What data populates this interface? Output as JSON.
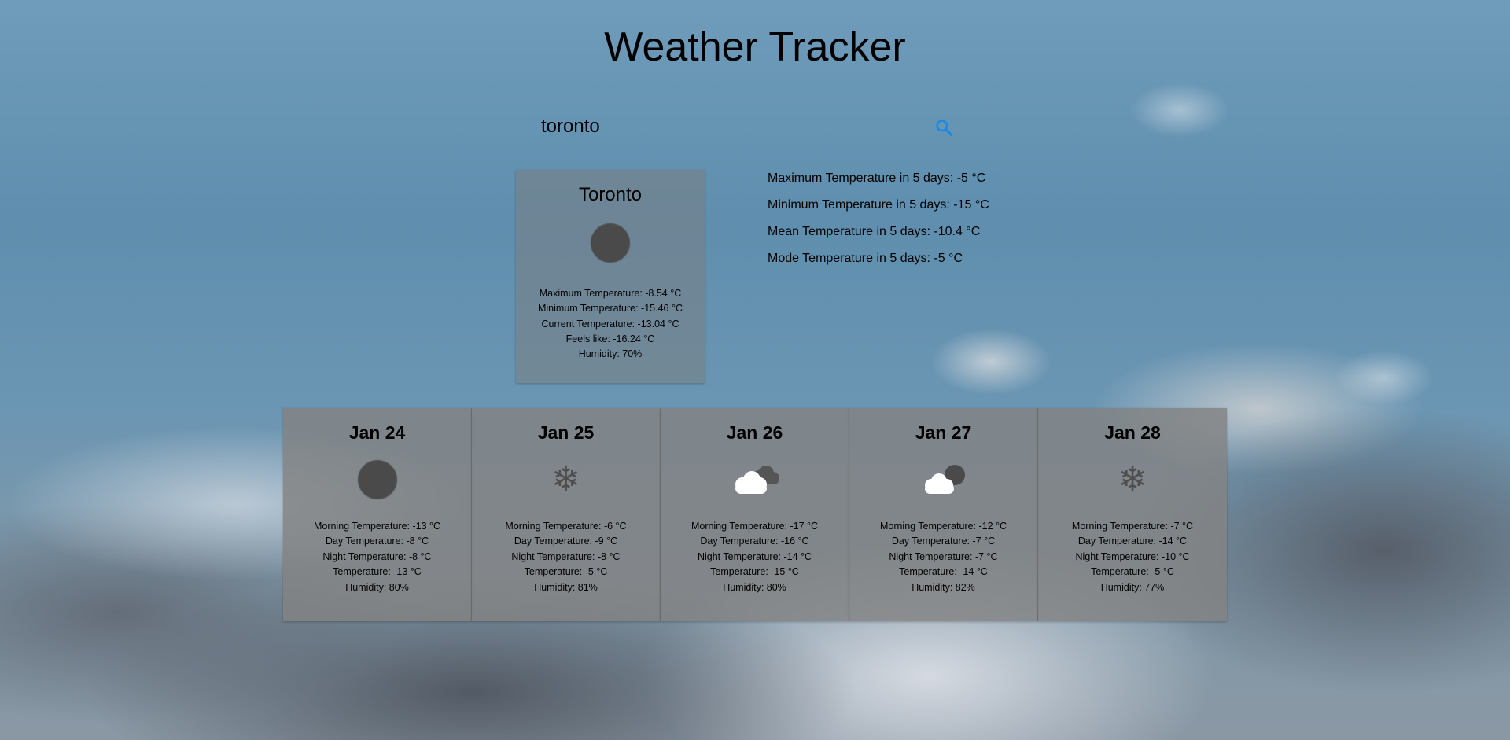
{
  "app": {
    "title": "Weather Tracker"
  },
  "search": {
    "value": "toronto",
    "button_icon": "search-icon",
    "accent_color": "#1e88e5"
  },
  "current": {
    "city": "Toronto",
    "icon": "dark-circle-icon",
    "stats": [
      "Maximum Temperature: -8.54 °C",
      "Minimum Temperature: -15.46 °C",
      "Current Temperature: -13.04 °C",
      "Feels like: -16.24 °C",
      "Humidity: 70%"
    ]
  },
  "summary": {
    "lines": [
      "Maximum Temperature in 5 days: -5 °C",
      "Minimum Temperature in 5 days: -15 °C",
      "Mean Temperature in 5 days: -10.4 °C",
      "Mode Temperature in 5 days: -5 °C"
    ]
  },
  "forecast": [
    {
      "date": "Jan 24",
      "icon": "dark-circle-icon",
      "lines": [
        "Morning Temperature: -13 °C",
        "Day Temperature: -8 °C",
        "Night Temperature: -8 °C",
        "Temperature: -13 °C",
        "Humidity: 80%"
      ]
    },
    {
      "date": "Jan 25",
      "icon": "snowflake-icon",
      "lines": [
        "Morning Temperature: -6 °C",
        "Day Temperature: -9 °C",
        "Night Temperature: -8 °C",
        "Temperature: -5 °C",
        "Humidity: 81%"
      ]
    },
    {
      "date": "Jan 26",
      "icon": "cloudy-icon",
      "lines": [
        "Morning Temperature: -17 °C",
        "Day Temperature: -16 °C",
        "Night Temperature: -14 °C",
        "Temperature: -15 °C",
        "Humidity: 80%"
      ]
    },
    {
      "date": "Jan 27",
      "icon": "partly-cloudy-icon",
      "lines": [
        "Morning Temperature: -12 °C",
        "Day Temperature: -7 °C",
        "Night Temperature: -7 °C",
        "Temperature: -14 °C",
        "Humidity: 82%"
      ]
    },
    {
      "date": "Jan 28",
      "icon": "snowflake-icon",
      "lines": [
        "Morning Temperature: -7 °C",
        "Day Temperature: -14 °C",
        "Night Temperature: -10 °C",
        "Temperature: -5 °C",
        "Humidity: 77%"
      ]
    }
  ]
}
